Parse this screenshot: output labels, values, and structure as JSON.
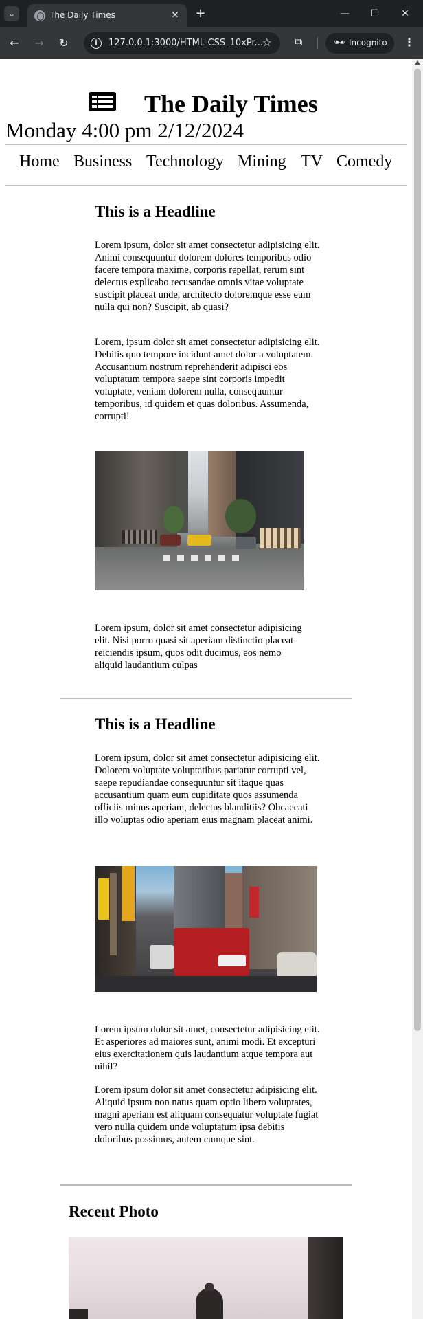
{
  "browser": {
    "tab_title": "The Daily Times",
    "url": "127.0.0.1:3000/HTML-CSS_10xPr...",
    "profile_label": "Incognito"
  },
  "page": {
    "site_title": "The Daily Times",
    "date_line": "Monday 4:00 pm 2/12/2024",
    "nav": [
      "Home",
      "Business",
      "Technology",
      "Mining",
      "TV",
      "Comedy"
    ],
    "articles": [
      {
        "headline": "This is a Headline",
        "paragraphs_before": [
          "Lorem ipsum, dolor sit amet consectetur adipisicing elit. Animi consequuntur dolorem dolores temporibus odio facere tempora maxime, corporis repellat, rerum sint delectus explicabo recusandae omnis vitae voluptate suscipit placeat unde, architecto doloremque esse eum nulla qui non? Suscipit, ab quasi?",
          "Lorem, ipsum dolor sit amet consectetur adipisicing elit. Debitis quo tempore incidunt amet dolor a voluptatem. Accusantium nostrum reprehenderit adipisci eos voluptatum tempora saepe sint corporis impedit voluptate, veniam dolorem nulla, consequuntur temporibus, id quidem et quas doloribus. Assumenda, corrupti!"
        ],
        "image": "city-street-photo",
        "paragraphs_after": [
          "Lorem ipsum, dolor sit amet consectetur adipisicing elit. Nisi porro quasi sit aperiam distinctio placeat reiciendis ipsum, quos odit ducimus, eos nemo aliquid laudantium culpas"
        ]
      },
      {
        "headline": "This is a Headline",
        "paragraphs_before": [
          "Lorem ipsum, dolor sit amet consectetur adipisicing elit. Dolorem voluptate voluptatibus pariatur corrupti vel, saepe repudiandae consequuntur sit itaque quas accusantium quam eum cupiditate quos assumenda officiis minus aperiam, delectus blanditiis? Obcaecati illo voluptas odio aperiam eius magnam placeat animi."
        ],
        "image": "fire-truck-photo",
        "paragraphs_after": [
          "Lorem ipsum dolor sit amet, consectetur adipisicing elit. Et asperiores ad maiores sunt, animi modi. Et excepturi eius exercitationem quis laudantium atque tempora aut nihil?",
          "Lorem ipsum dolor sit amet consectetur adipisicing elit. Aliquid ipsum non natus quam optio libero voluptates, magni aperiam est aliquam consequatur voluptate fugiat vero nulla quidem unde voluptatum ipsa debitis doloribus possimus, autem cumque sint."
        ]
      }
    ],
    "recent": {
      "heading": "Recent Photo",
      "image": "flatiron-building-photo"
    }
  }
}
